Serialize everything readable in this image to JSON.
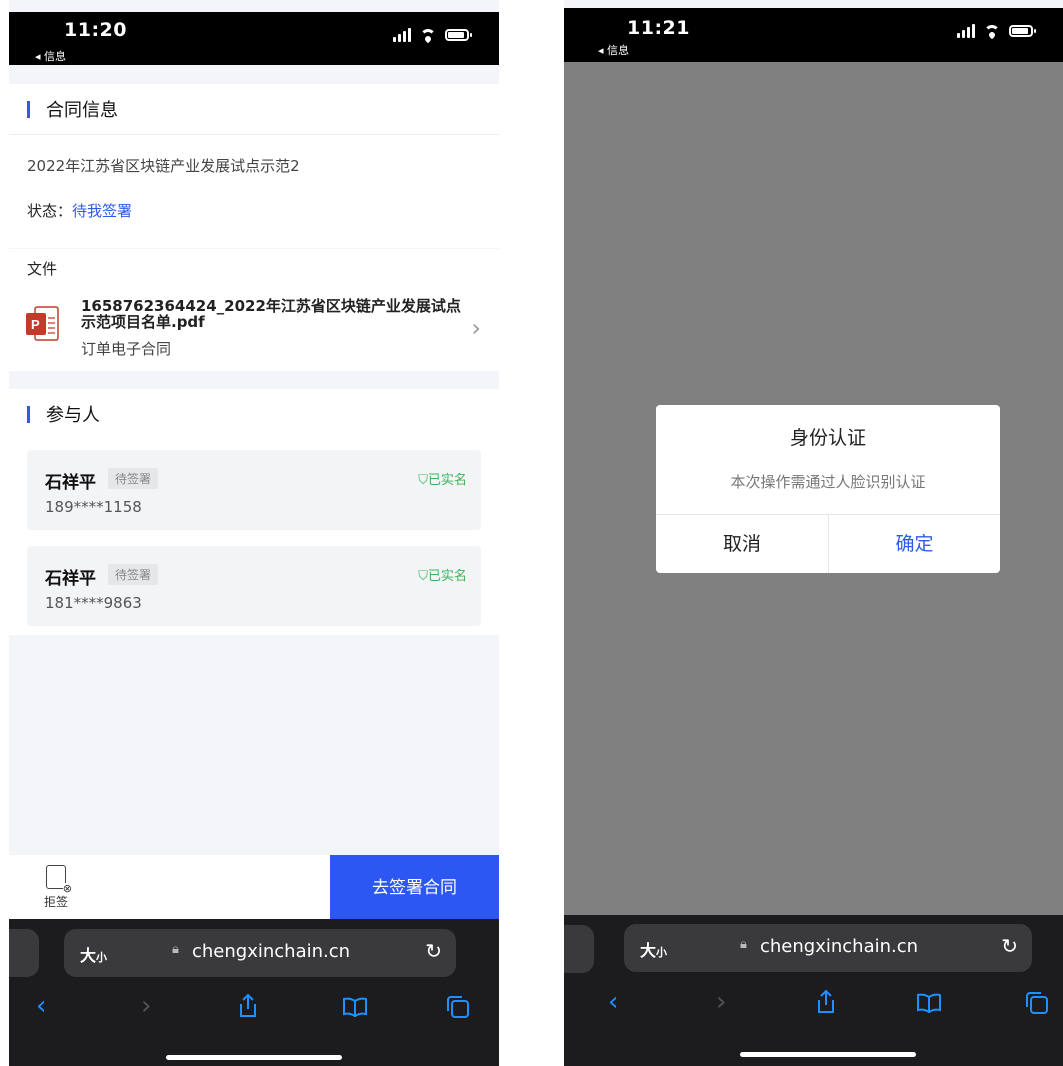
{
  "left": {
    "status_time": "11:20",
    "back_label": "◂ 信息",
    "contract_section_title": "合同信息",
    "contract_name": "2022年江苏省区块链产业发展试点示范2",
    "status_label": "状态：",
    "status_value": "待我签署",
    "file_label": "文件",
    "file_name": "1658762364424_2022年江苏省区块链产业发展试点示范项目名单.pdf",
    "file_subtitle": "订单电子合同",
    "participants_title": "参与人",
    "participants": [
      {
        "name": "石祥平",
        "tag": "待签署",
        "verified": "已实名",
        "phone": "189****1158"
      },
      {
        "name": "石祥平",
        "tag": "待签署",
        "verified": "已实名",
        "phone": "181****9863"
      }
    ],
    "reject_label": "拒签",
    "sign_button": "去签署合同"
  },
  "right": {
    "status_time": "11:21",
    "back_label": "◂ 信息",
    "dialog": {
      "title": "身份认证",
      "message": "本次操作需通过人脸识别认证",
      "cancel": "取消",
      "confirm": "确定"
    }
  },
  "browser": {
    "text_size_label": "大",
    "text_size_small": "小",
    "url": "chengxinchain.cn"
  },
  "colors": {
    "accent": "#2f5bea",
    "verified": "#3bb35c",
    "overlay": "#808081"
  }
}
